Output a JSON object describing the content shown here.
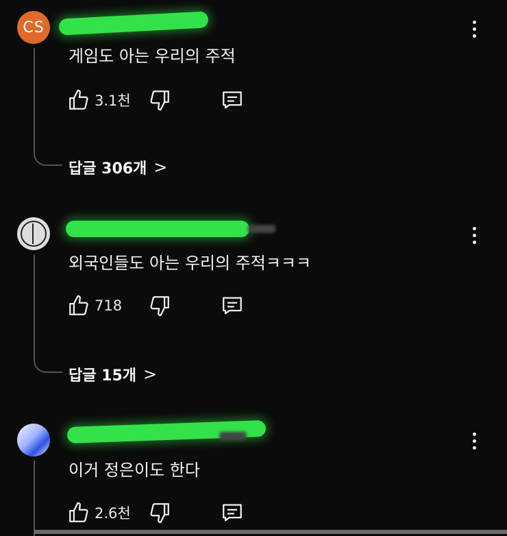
{
  "comments": [
    {
      "avatar_initials": "CS",
      "text": "게임도 아는 우리의 주적",
      "likes": "3.1천",
      "replies_label": "답글 306개",
      "chevron": ">"
    },
    {
      "avatar_initials": "",
      "text": "외국인들도 아는 우리의 주적ㅋㅋㅋ",
      "likes": "718",
      "replies_label": "답글 15개",
      "chevron": ">"
    },
    {
      "avatar_initials": "",
      "text": "이거 정은이도 한다",
      "likes": "2.6천"
    }
  ],
  "colors": {
    "background": "#0b0b0b",
    "redaction": "#33e24a",
    "avatar_cs": "#e06a2a"
  },
  "icons": [
    "like-icon",
    "dislike-icon",
    "reply-icon",
    "more-vert-icon"
  ]
}
